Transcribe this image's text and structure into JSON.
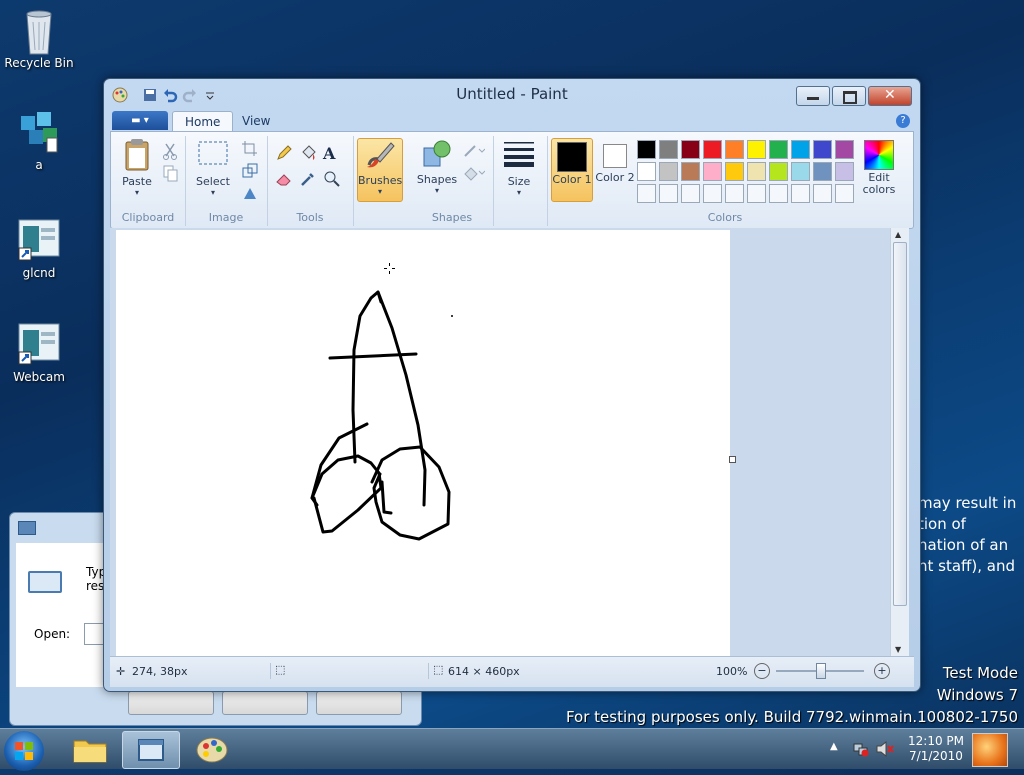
{
  "desktop": {
    "icons": [
      {
        "label": "Recycle Bin"
      },
      {
        "label": "a"
      },
      {
        "label": "glcnd"
      },
      {
        "label": "Webcam"
      }
    ],
    "bg_text_lines": [
      "may result in",
      "tion of",
      "nation of an",
      "nt staff), and"
    ],
    "watermark": {
      "line1": "Test Mode",
      "line2": "Windows 7",
      "line3": "For testing purposes only. Build 7792.winmain.100802-1750"
    }
  },
  "run_dialog": {
    "text_line1": "Type",
    "text_line2": "reso",
    "open_label": "Open:"
  },
  "paint": {
    "title": "Untitled - Paint",
    "tabs": [
      "Home",
      "View"
    ],
    "groups": {
      "clipboard": {
        "label": "Clipboard",
        "paste": "Paste"
      },
      "image": {
        "label": "Image",
        "select": "Select"
      },
      "tools": {
        "label": "Tools"
      },
      "brushes": {
        "label": "Brushes"
      },
      "shapes": {
        "label": "Shapes",
        "shapes_btn": "Shapes"
      },
      "size": {
        "label": "Size"
      },
      "colors": {
        "label": "Colors",
        "color1": "Color 1",
        "color2": "Color 2",
        "edit": "Edit colors",
        "row1": [
          "#000000",
          "#7f7f7f",
          "#880015",
          "#ed1c24",
          "#ff7f27",
          "#fff200",
          "#22b14c",
          "#00a2e8",
          "#3f48cc",
          "#a349a4"
        ],
        "row2": [
          "#ffffff",
          "#c3c3c3",
          "#b97a57",
          "#ffaec9",
          "#ffc90e",
          "#efe4b0",
          "#b5e61d",
          "#99d9ea",
          "#7092be",
          "#c8bfe7"
        ]
      }
    },
    "status": {
      "cursor_pos": "274, 38px",
      "canvas_size": "614 × 460px",
      "zoom": "100%"
    }
  },
  "taskbar": {
    "time": "12:10 PM",
    "date": "7/1/2010"
  }
}
